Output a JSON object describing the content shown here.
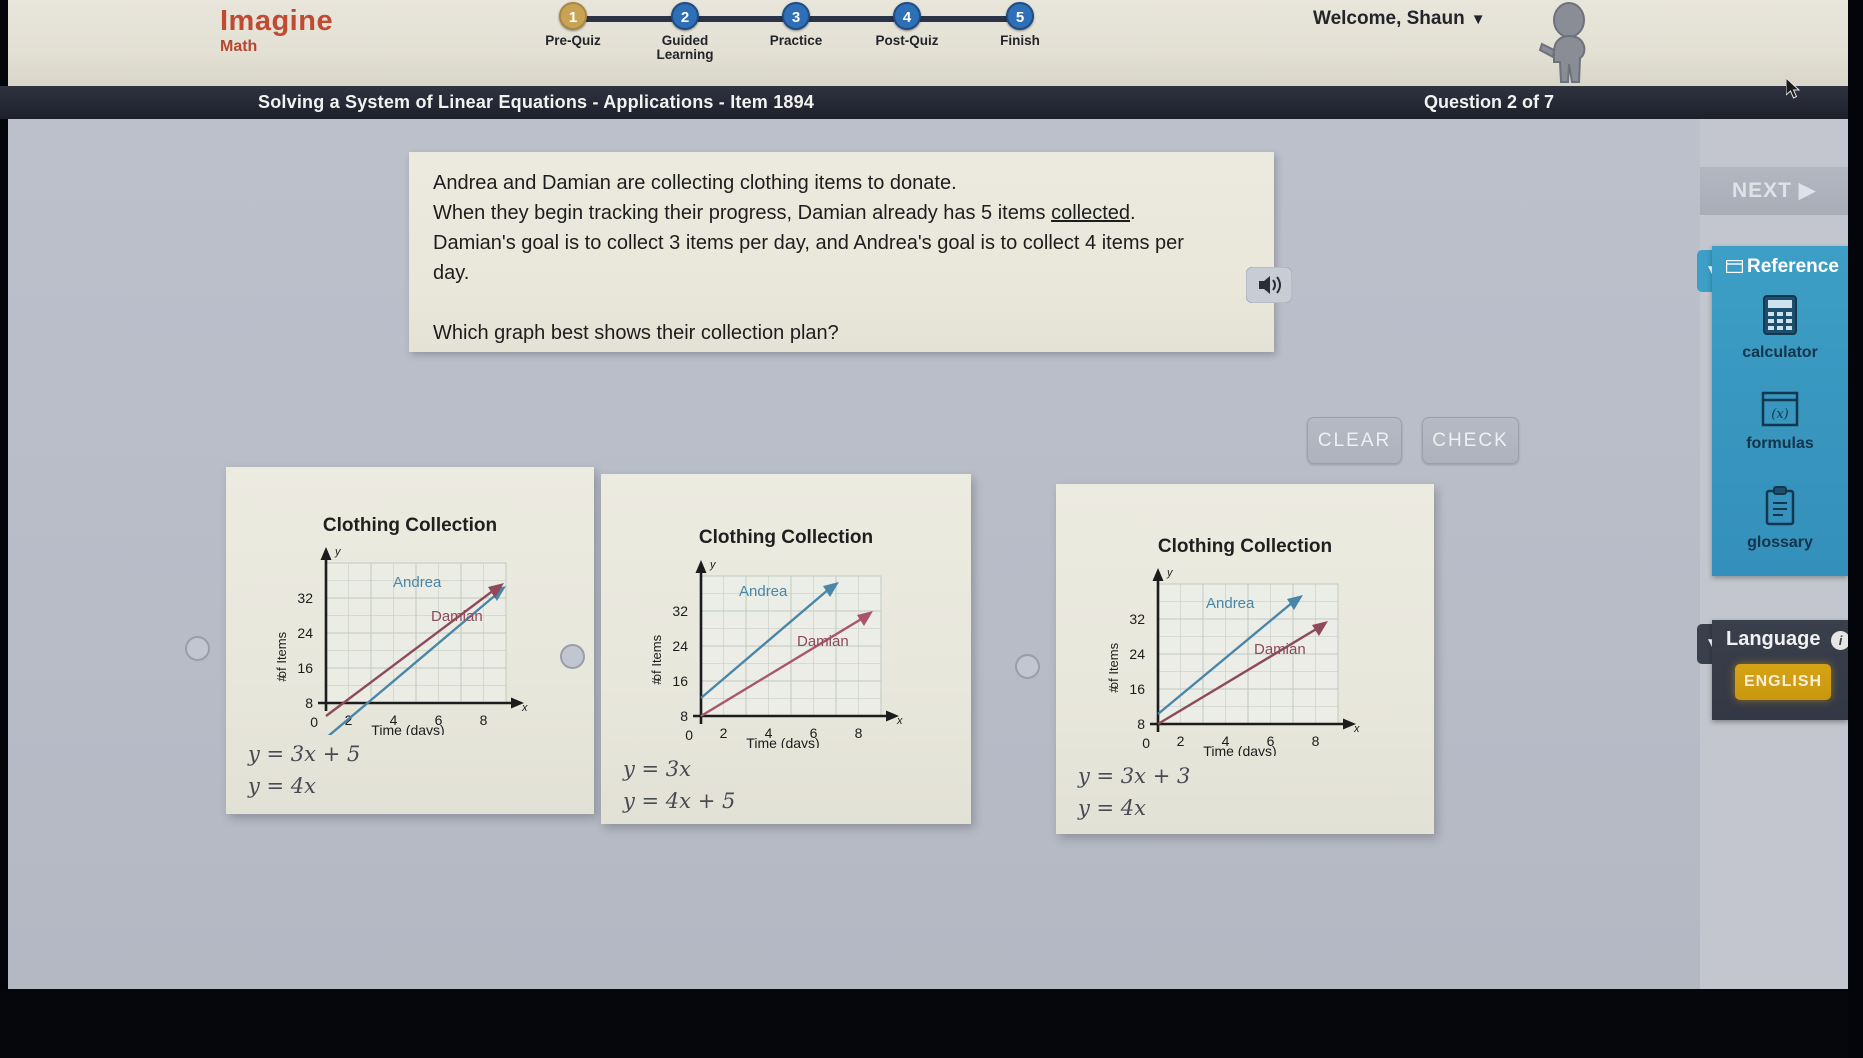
{
  "header": {
    "brand_line1": "Imagine",
    "brand_line2": "Math",
    "welcome": "Welcome, Shaun",
    "welcome_caret": "▼",
    "avatar_name": "student-avatar",
    "steps": [
      {
        "num": "1",
        "label": "Pre-Quiz",
        "state": "current",
        "color": "#c9a355"
      },
      {
        "num": "2",
        "label": "Guided\nLearning",
        "state": "upcoming",
        "color": "#2f6fb5"
      },
      {
        "num": "3",
        "label": "Practice",
        "state": "upcoming",
        "color": "#2f6fb5"
      },
      {
        "num": "4",
        "label": "Post-Quiz",
        "state": "upcoming",
        "color": "#2f6fb5"
      },
      {
        "num": "5",
        "label": "Finish",
        "state": "upcoming",
        "color": "#2f6fb5"
      }
    ]
  },
  "titlebar": {
    "lesson_title": "Solving a System of Linear Equations - Applications - Item 1894",
    "question_counter": "Question 2 of 7"
  },
  "prompt": {
    "line1": "Andrea and Damian are collecting clothing items to donate.",
    "line2_a": "When they begin tracking their progress, Damian already has 5 items ",
    "line2_underlined": "collected",
    "line2_b": ".",
    "line3": "Damian's goal is to collect 3 items per day, and Andrea's goal is to collect 4 items per",
    "line4": "day.",
    "line5": "Which graph best shows their collection plan?",
    "speaker_icon": "audio-speaker-icon"
  },
  "actions": {
    "clear_label": "CLEAR",
    "check_label": "CHECK",
    "next_label": "NEXT",
    "next_arrow": "▶"
  },
  "sidebar": {
    "reference_label": "Reference",
    "reference_caret": "▼",
    "reference_window_icon": "window-icon",
    "tools": [
      {
        "label": "calculator",
        "icon": "calculator-icon"
      },
      {
        "label": "formulas",
        "icon": "formulas-icon"
      },
      {
        "label": "glossary",
        "icon": "glossary-clipboard-icon"
      }
    ],
    "language_label": "Language",
    "language_caret": "▼",
    "language_info": "i",
    "language_value": "ENGLISH",
    "accent_blue": "#3d9fc6",
    "accent_navy": "#3a3f4c",
    "accent_gold": "#d6a316"
  },
  "choices": [
    {
      "id": "A",
      "selected": false,
      "chart_title": "Clothing Collection",
      "equation1": "y = 3x + 5",
      "equation2": "y = 4x"
    },
    {
      "id": "B",
      "selected": false,
      "chart_title": "Clothing Collection",
      "equation1": "y = 3x",
      "equation2": "y = 4x + 5"
    },
    {
      "id": "C",
      "selected": false,
      "chart_title": "Clothing Collection",
      "equation1": "y = 3x + 3",
      "equation2": "y = 4x"
    }
  ],
  "chart_data": [
    {
      "type": "line",
      "id": "A",
      "title": "Clothing Collection",
      "xlabel": "Time (days)",
      "ylabel": "# of Items",
      "xticks": [
        2,
        4,
        6,
        8
      ],
      "yticks": [
        8,
        16,
        24,
        32
      ],
      "origin_label": "0",
      "x_axis_arrow_label": "x",
      "y_axis_arrow_label": "y",
      "xlim": [
        0,
        10
      ],
      "ylim": [
        0,
        40
      ],
      "grid": true,
      "series": [
        {
          "name": "Andrea",
          "color": "#4a86a8",
          "intercept": 0,
          "slope": 4,
          "x_end": 8.2
        },
        {
          "name": "Damian",
          "color": "#8e4a5b",
          "intercept": 5,
          "slope": 3,
          "x_end": 9.0
        }
      ]
    },
    {
      "type": "line",
      "id": "B",
      "title": "Clothing Collection",
      "xlabel": "Time (days)",
      "ylabel": "# of Items",
      "xticks": [
        2,
        4,
        6,
        8
      ],
      "yticks": [
        8,
        16,
        24,
        32
      ],
      "origin_label": "0",
      "x_axis_arrow_label": "x",
      "y_axis_arrow_label": "y",
      "xlim": [
        0,
        10
      ],
      "ylim": [
        0,
        40
      ],
      "grid": true,
      "series": [
        {
          "name": "Andrea",
          "color": "#4a86a8",
          "intercept": 5,
          "slope": 4,
          "x_end": 7.5
        },
        {
          "name": "Damian",
          "color": "#a9566a",
          "intercept": 0,
          "slope": 3,
          "x_end": 9.2
        }
      ]
    },
    {
      "type": "line",
      "id": "C",
      "title": "Clothing Collection",
      "xlabel": "Time (days)",
      "ylabel": "# of Items",
      "xticks": [
        2,
        4,
        6,
        8
      ],
      "yticks": [
        8,
        16,
        24,
        32
      ],
      "origin_label": "0",
      "x_axis_arrow_label": "x",
      "y_axis_arrow_label": "y",
      "xlim": [
        0,
        10
      ],
      "ylim": [
        0,
        40
      ],
      "grid": true,
      "series": [
        {
          "name": "Andrea",
          "color": "#4a86a8",
          "intercept": 3,
          "slope": 4,
          "x_end": 7.4
        },
        {
          "name": "Damian",
          "color": "#8e4a5b",
          "intercept": 0,
          "slope": 3,
          "x_end": 9.2
        }
      ]
    }
  ]
}
